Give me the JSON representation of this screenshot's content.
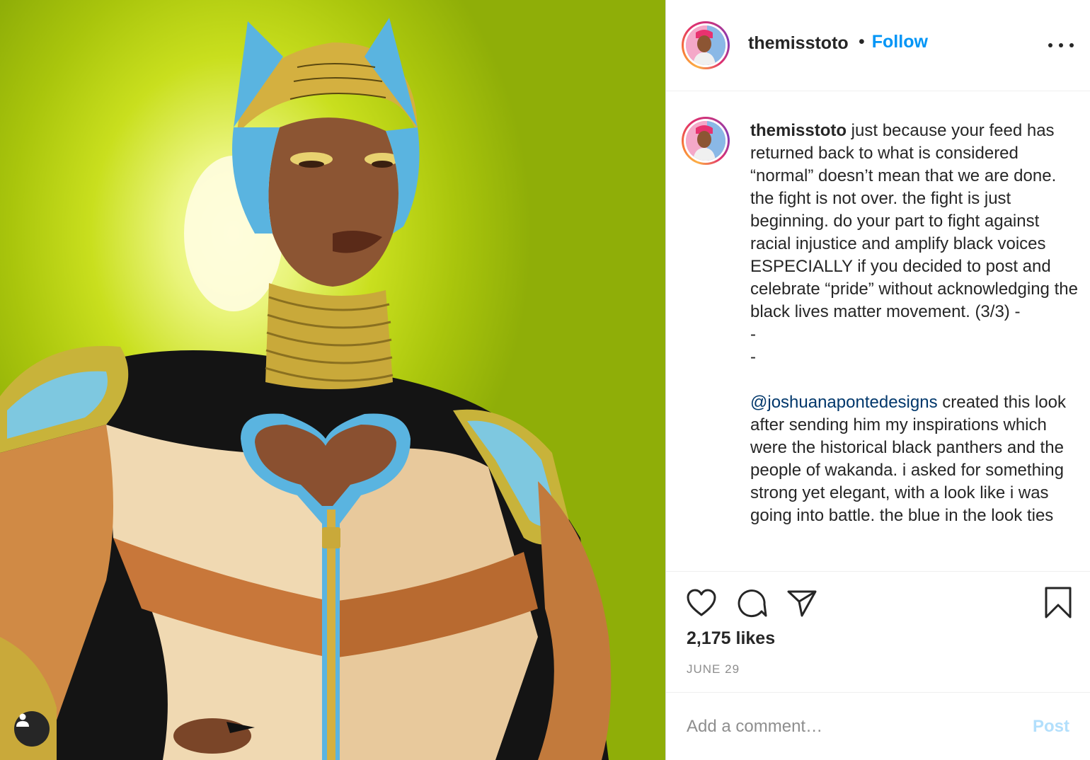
{
  "header": {
    "username": "themisstoto",
    "bullet": "•",
    "follow_label": "Follow"
  },
  "caption": {
    "username": "themisstoto",
    "text_part1": " just because your feed has returned back to what is considered “normal” doesn’t mean that we are done. the fight is not over. the fight is just beginning. do your part to fight against racial injustice and amplify black voices ESPECIALLY if you decided to post and celebrate “pride” without acknowledging the black lives matter movement. (3/3) -\n-\n-\n\n",
    "mention": "@joshuanapontedesigns",
    "text_part2": " created this look after sending him my inspirations which were the historical black panthers and the people of wakanda. i asked for something strong yet elegant, with a look like i was going into battle. the blue in the look ties"
  },
  "actions": {
    "likes": "2,175 likes",
    "date": "JUNE 29"
  },
  "comment_box": {
    "placeholder": "Add a comment…",
    "post_label": "Post"
  },
  "icons": {
    "like": "heart-icon",
    "comment": "comment-icon",
    "share": "share-icon",
    "save": "bookmark-icon",
    "more": "more-options-icon",
    "tags": "user-tag-icon"
  },
  "colors": {
    "follow": "#0095f6",
    "post_disabled": "#b2dffc",
    "mention": "#00376b",
    "photo_background": "#c9df1e"
  }
}
